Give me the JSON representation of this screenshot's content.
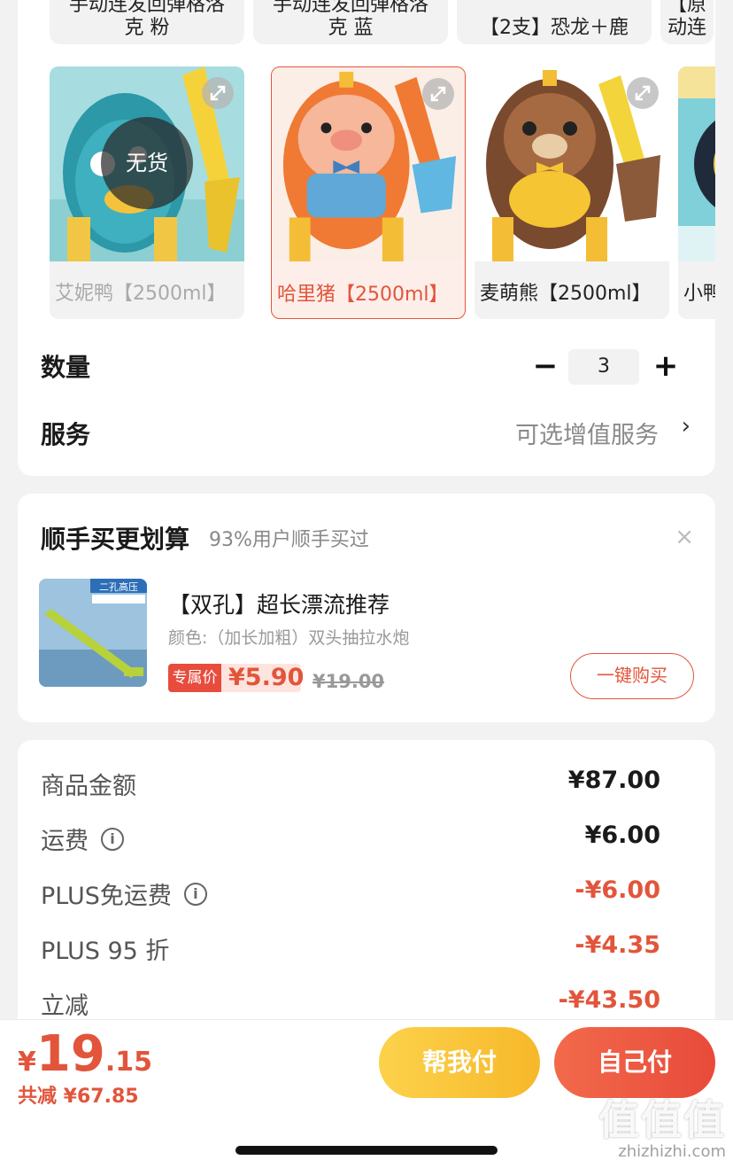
{
  "spec": {
    "top_chips": [
      {
        "line1": "手动连发回弹格洛",
        "line2": "克 粉"
      },
      {
        "line1": "手动连发回弹格洛",
        "line2": "克 蓝"
      },
      {
        "line1": "",
        "line2": "【2支】恐龙＋鹿"
      },
      {
        "line1": "【原",
        "line2": "动连"
      }
    ],
    "variants": [
      {
        "label": "艾妮鸭【2500ml】",
        "state": "soldout",
        "badge": "无货"
      },
      {
        "label": "哈里猪【2500ml】",
        "state": "selected"
      },
      {
        "label": "麦萌熊【2500ml】",
        "state": "normal"
      },
      {
        "label": "小鸭子",
        "state": "normal"
      }
    ],
    "quantity_label": "数量",
    "quantity_minus": "−",
    "quantity_value": "3",
    "quantity_plus": "+",
    "service_label": "服务",
    "service_value": "可选增值服务",
    "service_chevron": "›"
  },
  "upsell": {
    "title": "顺手买更划算",
    "subtitle": "93%用户顺手买过",
    "close": "×",
    "product_name": "【双孔】超长漂流推荐",
    "product_variant": "颜色:（加长加粗）双头抽拉水炮",
    "price_tag": "专属价",
    "price": "¥5.90",
    "original_price": "¥19.00",
    "buy_button": "一键购买",
    "thumb_text": "二孔高压"
  },
  "summary": {
    "rows": [
      {
        "label": "商品金额",
        "value": "¥87.00",
        "info": false,
        "negative": false
      },
      {
        "label": "运费",
        "value": "¥6.00",
        "info": true,
        "negative": false
      },
      {
        "label": "PLUS免运费",
        "value": "-¥6.00",
        "info": true,
        "negative": true
      },
      {
        "label": "PLUS 95 折",
        "value": "-¥4.35",
        "info": false,
        "negative": true
      },
      {
        "label": "立减",
        "value": "-¥43.50",
        "info": false,
        "negative": true
      }
    ]
  },
  "bottom": {
    "total_symbol": "¥",
    "total_int": "19",
    "total_dec": ".15",
    "saved_text": "共减 ¥67.85",
    "help_pay": "帮我付",
    "self_pay": "自己付"
  },
  "watermark": {
    "big": "值值值",
    "small": "zhizhizhi.com"
  },
  "colors": {
    "accent": "#e2553b",
    "yellow_button": "#f7b82a",
    "red_button": "#e84a3a"
  }
}
